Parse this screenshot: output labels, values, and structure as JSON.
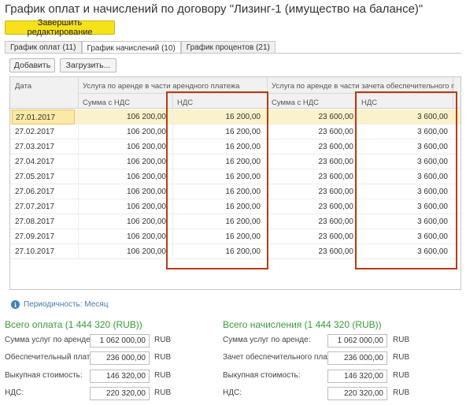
{
  "window": {
    "title": "График оплат и начислений по договору \"Лизинг-1 (имущество на балансе)\""
  },
  "toolbar": {
    "finish_edit": "Завершить редактирование",
    "add": "Добавить",
    "load": "Загрузить..."
  },
  "tabs": [
    {
      "label": "График оплат (11)"
    },
    {
      "label": "График начислений (10)"
    },
    {
      "label": "График процентов (21)"
    }
  ],
  "table": {
    "col_date": "Дата",
    "group1": "Услуга по аренде в части арендного платежа",
    "group2": "Услуга по аренде в части зачета обеспечительного пл...",
    "sub_sum": "Сумма с НДС",
    "sub_vat": "НДС",
    "rows": [
      {
        "date": "27.01.2017",
        "sum1": "106 200,00",
        "vat1": "16 200,00",
        "sum2": "23 600,00",
        "vat2": "3 600,00"
      },
      {
        "date": "27.02.2017",
        "sum1": "106 200,00",
        "vat1": "16 200,00",
        "sum2": "23 600,00",
        "vat2": "3 600,00"
      },
      {
        "date": "27.03.2017",
        "sum1": "106 200,00",
        "vat1": "16 200,00",
        "sum2": "23 600,00",
        "vat2": "3 600,00"
      },
      {
        "date": "27.04.2017",
        "sum1": "106 200,00",
        "vat1": "16 200,00",
        "sum2": "23 600,00",
        "vat2": "3 600,00"
      },
      {
        "date": "27.05.2017",
        "sum1": "106 200,00",
        "vat1": "16 200,00",
        "sum2": "23 600,00",
        "vat2": "3 600,00"
      },
      {
        "date": "27.06.2017",
        "sum1": "106 200,00",
        "vat1": "16 200,00",
        "sum2": "23 600,00",
        "vat2": "3 600,00"
      },
      {
        "date": "27.07.2017",
        "sum1": "106 200,00",
        "vat1": "16 200,00",
        "sum2": "23 600,00",
        "vat2": "3 600,00"
      },
      {
        "date": "27.08.2017",
        "sum1": "106 200,00",
        "vat1": "16 200,00",
        "sum2": "23 600,00",
        "vat2": "3 600,00"
      },
      {
        "date": "27.09.2017",
        "sum1": "106 200,00",
        "vat1": "16 200,00",
        "sum2": "23 600,00",
        "vat2": "3 600,00"
      },
      {
        "date": "27.10.2017",
        "sum1": "106 200,00",
        "vat1": "16 200,00",
        "sum2": "23 600,00",
        "vat2": "3 600,00"
      }
    ]
  },
  "periodicity": "Периодичность: Месяц",
  "payments": {
    "title": "Всего оплата (1 444 320 (RUB))",
    "fields": [
      {
        "label": "Сумма услуг по аренде:",
        "value": "1 062 000,00",
        "currency": "RUB"
      },
      {
        "label": "Обеспечительный платеж:",
        "value": "236 000,00",
        "currency": "RUB"
      },
      {
        "label": "Выкупная стоимость:",
        "value": "146 320,00",
        "currency": "RUB"
      },
      {
        "label": "НДС:",
        "value": "220 320,00",
        "currency": "RUB"
      }
    ]
  },
  "accruals": {
    "title": "Всего начисления (1 444 320 (RUB))",
    "fields": [
      {
        "label": "Сумма услуг по аренде:",
        "value": "1 062 000,00",
        "currency": "RUB"
      },
      {
        "label": "Зачет обеспечительного платежа:",
        "value": "236 000,00",
        "currency": "RUB"
      },
      {
        "label": "Выкупная стоимость:",
        "value": "146 320,00",
        "currency": "RUB"
      },
      {
        "label": "НДС:",
        "value": "220 320,00",
        "currency": "RUB"
      }
    ]
  },
  "colors": {
    "accent_button": "#f7e11a",
    "highlight_box": "#b83a16",
    "section_title": "#3a9a3a",
    "selected_row": "#fbf2c9"
  }
}
